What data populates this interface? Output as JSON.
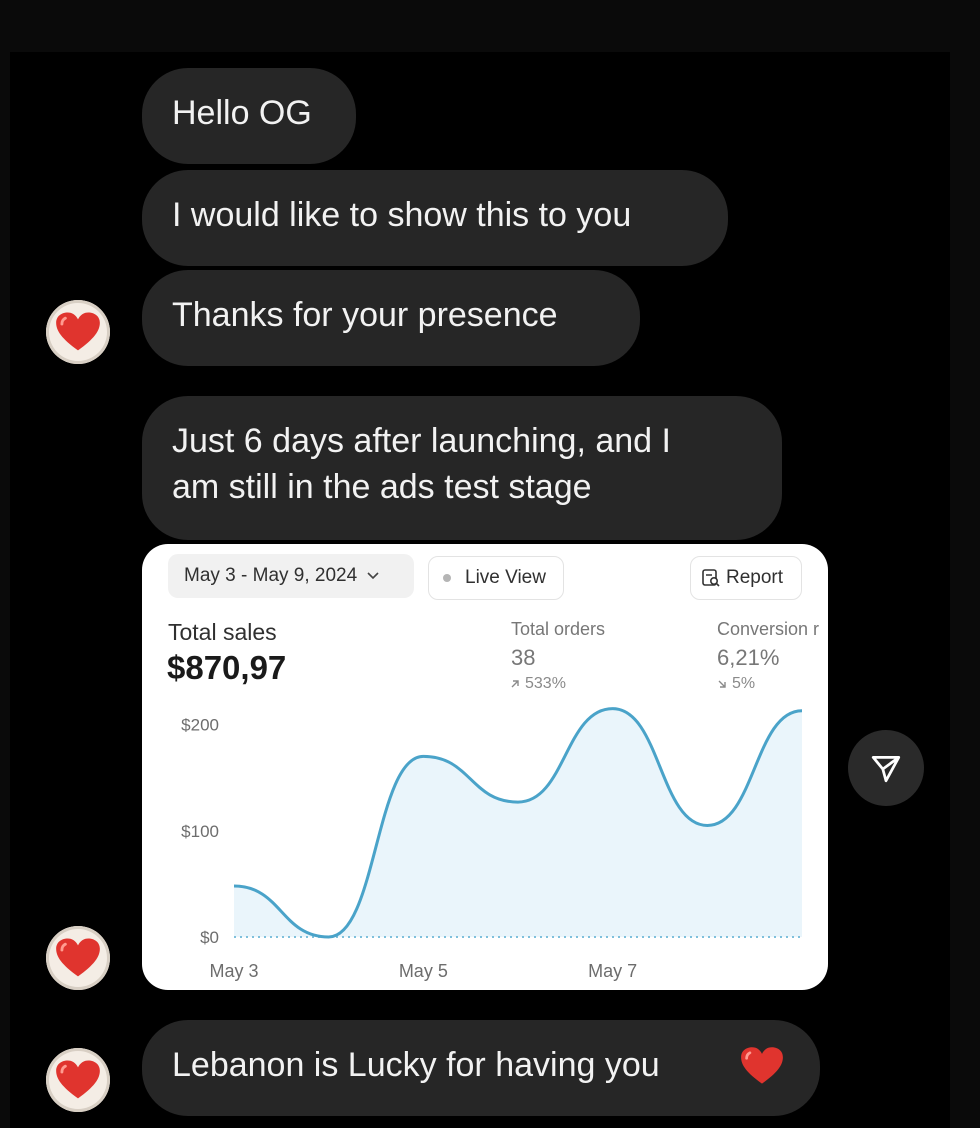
{
  "messages": [
    {
      "text": "Hello OG"
    },
    {
      "text": "I would like to show this to you"
    },
    {
      "text": "Thanks for your presence"
    },
    {
      "line1": "Just 6 days after launching, and I",
      "line2": "am still in the ads test stage"
    },
    {
      "text": "Lebanon is Lucky for having you"
    }
  ],
  "reaction_icon": "heart-icon",
  "dashboard": {
    "date_range": "May 3 - May 9, 2024",
    "live_view": "Live View",
    "report": "Report",
    "total_sales_label": "Total sales",
    "total_sales_value": "$870,97",
    "total_orders_label": "Total orders",
    "total_orders_value": "38",
    "total_orders_delta": "533%",
    "conversion_label": "Conversion r",
    "conversion_value": "6,21%",
    "conversion_delta": "5%"
  },
  "chart_data": {
    "type": "area",
    "x": [
      "May 3",
      "May 4",
      "May 5",
      "May 6",
      "May 7",
      "May 8",
      "May 9"
    ],
    "values": [
      48,
      0,
      170,
      127,
      215,
      105,
      213
    ],
    "x_tick_labels": [
      "May 3",
      "May 5",
      "May 7"
    ],
    "y_tick_labels": [
      "$0",
      "$100",
      "$200"
    ],
    "ylim": [
      0,
      240
    ],
    "line_color": "#4aa3c9",
    "fill_color": "#eaf5fb",
    "baseline_color": "#7fc0dc"
  },
  "send_icon": "send-icon"
}
